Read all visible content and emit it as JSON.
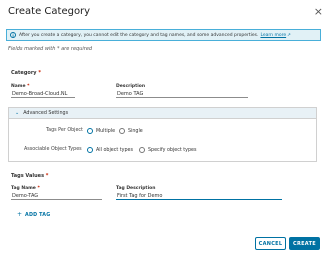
{
  "dialog": {
    "title": "Create Category",
    "close_glyph": "×"
  },
  "info": {
    "text": "After you create a category, you cannot edit the category and tag names, and some advanced properties.",
    "link_text": "Learn more",
    "icon": "info-icon",
    "link_icon": "external-link-icon"
  },
  "required_note": "Fields marked with  *  are required",
  "category": {
    "section_label": "Category",
    "name_label": "Name",
    "name_value": "Demo-Broad-Cloud.NL",
    "description_label": "Description",
    "description_value": "Demo TAG"
  },
  "advanced": {
    "header": "Advanced Settings",
    "tags_per_object_label": "Tags Per Object",
    "tags_per_object_options": [
      "Multiple",
      "Single"
    ],
    "tags_per_object_selected": "Multiple",
    "associable_label": "Associable Object Types",
    "associable_options": [
      "All object types",
      "Specify object types"
    ],
    "associable_selected": "All object types"
  },
  "tag_values": {
    "section_label": "Tags Values",
    "tag_name_label": "Tag Name",
    "tag_name_value": "Demo-TAG",
    "tag_description_label": "Tag Description",
    "tag_description_value": "First Tag for Demo",
    "add_tag_label": "ADD TAG"
  },
  "footer": {
    "cancel_label": "CANCEL",
    "create_label": "CREATE"
  },
  "colors": {
    "accent": "#0072a3",
    "info_bg": "#e1f1f6",
    "required": "#c92100"
  }
}
